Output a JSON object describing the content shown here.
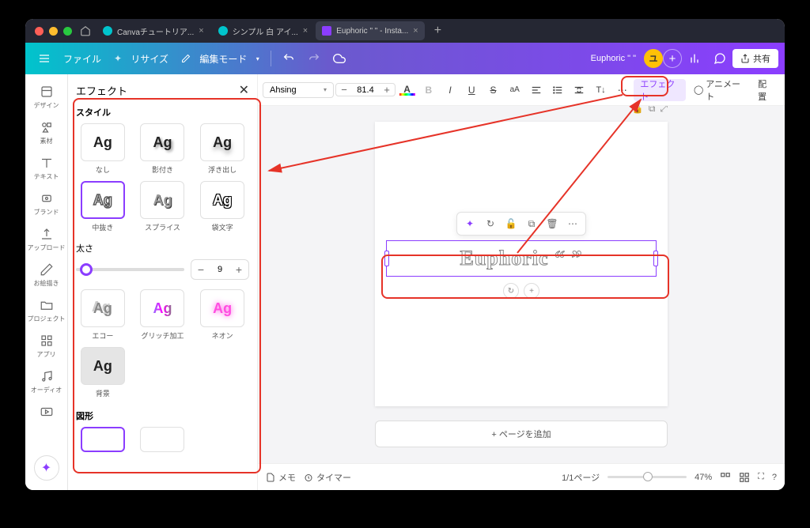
{
  "tabs": [
    {
      "label": "Canvaチュートリア..."
    },
    {
      "label": "シンプル 白 アイ..."
    },
    {
      "label": "Euphoric \" \" - Insta...",
      "active": true
    }
  ],
  "topbar": {
    "file": "ファイル",
    "resize": "リサイズ",
    "edit_mode": "編集モード",
    "doc_title": "Euphoric \" \"",
    "avatar_initial": "ユ",
    "share": "共有"
  },
  "leftnav": [
    {
      "key": "design",
      "label": "デザイン"
    },
    {
      "key": "elements",
      "label": "素材"
    },
    {
      "key": "text",
      "label": "テキスト"
    },
    {
      "key": "brand",
      "label": "ブランド"
    },
    {
      "key": "upload",
      "label": "アップロード"
    },
    {
      "key": "draw",
      "label": "お絵描き"
    },
    {
      "key": "projects",
      "label": "プロジェクト"
    },
    {
      "key": "apps",
      "label": "アプリ"
    },
    {
      "key": "audio",
      "label": "オーディオ"
    },
    {
      "key": "video",
      "label": ""
    }
  ],
  "panel": {
    "title": "エフェクト",
    "style_label": "スタイル",
    "effects": [
      {
        "key": "none",
        "label": "なし",
        "cls": ""
      },
      {
        "key": "shadow",
        "label": "影付き",
        "cls": "eff-shadow"
      },
      {
        "key": "lift",
        "label": "浮き出し",
        "cls": "eff-lift"
      },
      {
        "key": "outline",
        "label": "中抜き",
        "cls": "eff-outline",
        "selected": true
      },
      {
        "key": "splice",
        "label": "スプライス",
        "cls": "eff-splice"
      },
      {
        "key": "hollow",
        "label": "袋文字",
        "cls": "eff-hollow"
      },
      {
        "key": "echo",
        "label": "エコー",
        "cls": "eff-echo"
      },
      {
        "key": "glitch",
        "label": "グリッチ加工",
        "cls": "eff-glitch"
      },
      {
        "key": "neon",
        "label": "ネオン",
        "cls": "eff-neon"
      },
      {
        "key": "bg",
        "label": "背景",
        "cls": "eff-bg"
      }
    ],
    "thickness_label": "太さ",
    "thickness_value": "9",
    "shape_label": "図形"
  },
  "ctx": {
    "font": "Ahsing",
    "size": "81.4",
    "effects_label": "エフェクト",
    "animate_label": "アニメート",
    "position_label": "配置"
  },
  "canvas": {
    "text": "Euphoric “ ”",
    "add_page": "+ ページを追加"
  },
  "bottom": {
    "notes": "メモ",
    "timer": "タイマー",
    "pages": "1/1ページ",
    "zoom": "47%"
  }
}
